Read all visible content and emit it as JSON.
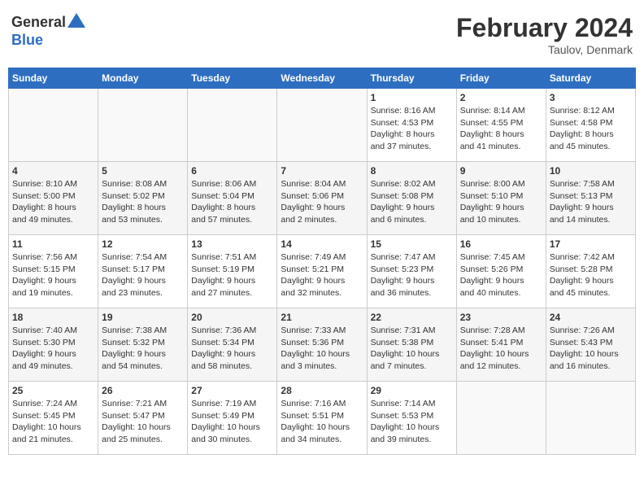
{
  "header": {
    "logo_general": "General",
    "logo_blue": "Blue",
    "title": "February 2024",
    "location": "Taulov, Denmark"
  },
  "weekdays": [
    "Sunday",
    "Monday",
    "Tuesday",
    "Wednesday",
    "Thursday",
    "Friday",
    "Saturday"
  ],
  "weeks": [
    [
      {
        "day": "",
        "info": ""
      },
      {
        "day": "",
        "info": ""
      },
      {
        "day": "",
        "info": ""
      },
      {
        "day": "",
        "info": ""
      },
      {
        "day": "1",
        "info": "Sunrise: 8:16 AM\nSunset: 4:53 PM\nDaylight: 8 hours\nand 37 minutes."
      },
      {
        "day": "2",
        "info": "Sunrise: 8:14 AM\nSunset: 4:55 PM\nDaylight: 8 hours\nand 41 minutes."
      },
      {
        "day": "3",
        "info": "Sunrise: 8:12 AM\nSunset: 4:58 PM\nDaylight: 8 hours\nand 45 minutes."
      }
    ],
    [
      {
        "day": "4",
        "info": "Sunrise: 8:10 AM\nSunset: 5:00 PM\nDaylight: 8 hours\nand 49 minutes."
      },
      {
        "day": "5",
        "info": "Sunrise: 8:08 AM\nSunset: 5:02 PM\nDaylight: 8 hours\nand 53 minutes."
      },
      {
        "day": "6",
        "info": "Sunrise: 8:06 AM\nSunset: 5:04 PM\nDaylight: 8 hours\nand 57 minutes."
      },
      {
        "day": "7",
        "info": "Sunrise: 8:04 AM\nSunset: 5:06 PM\nDaylight: 9 hours\nand 2 minutes."
      },
      {
        "day": "8",
        "info": "Sunrise: 8:02 AM\nSunset: 5:08 PM\nDaylight: 9 hours\nand 6 minutes."
      },
      {
        "day": "9",
        "info": "Sunrise: 8:00 AM\nSunset: 5:10 PM\nDaylight: 9 hours\nand 10 minutes."
      },
      {
        "day": "10",
        "info": "Sunrise: 7:58 AM\nSunset: 5:13 PM\nDaylight: 9 hours\nand 14 minutes."
      }
    ],
    [
      {
        "day": "11",
        "info": "Sunrise: 7:56 AM\nSunset: 5:15 PM\nDaylight: 9 hours\nand 19 minutes."
      },
      {
        "day": "12",
        "info": "Sunrise: 7:54 AM\nSunset: 5:17 PM\nDaylight: 9 hours\nand 23 minutes."
      },
      {
        "day": "13",
        "info": "Sunrise: 7:51 AM\nSunset: 5:19 PM\nDaylight: 9 hours\nand 27 minutes."
      },
      {
        "day": "14",
        "info": "Sunrise: 7:49 AM\nSunset: 5:21 PM\nDaylight: 9 hours\nand 32 minutes."
      },
      {
        "day": "15",
        "info": "Sunrise: 7:47 AM\nSunset: 5:23 PM\nDaylight: 9 hours\nand 36 minutes."
      },
      {
        "day": "16",
        "info": "Sunrise: 7:45 AM\nSunset: 5:26 PM\nDaylight: 9 hours\nand 40 minutes."
      },
      {
        "day": "17",
        "info": "Sunrise: 7:42 AM\nSunset: 5:28 PM\nDaylight: 9 hours\nand 45 minutes."
      }
    ],
    [
      {
        "day": "18",
        "info": "Sunrise: 7:40 AM\nSunset: 5:30 PM\nDaylight: 9 hours\nand 49 minutes."
      },
      {
        "day": "19",
        "info": "Sunrise: 7:38 AM\nSunset: 5:32 PM\nDaylight: 9 hours\nand 54 minutes."
      },
      {
        "day": "20",
        "info": "Sunrise: 7:36 AM\nSunset: 5:34 PM\nDaylight: 9 hours\nand 58 minutes."
      },
      {
        "day": "21",
        "info": "Sunrise: 7:33 AM\nSunset: 5:36 PM\nDaylight: 10 hours\nand 3 minutes."
      },
      {
        "day": "22",
        "info": "Sunrise: 7:31 AM\nSunset: 5:38 PM\nDaylight: 10 hours\nand 7 minutes."
      },
      {
        "day": "23",
        "info": "Sunrise: 7:28 AM\nSunset: 5:41 PM\nDaylight: 10 hours\nand 12 minutes."
      },
      {
        "day": "24",
        "info": "Sunrise: 7:26 AM\nSunset: 5:43 PM\nDaylight: 10 hours\nand 16 minutes."
      }
    ],
    [
      {
        "day": "25",
        "info": "Sunrise: 7:24 AM\nSunset: 5:45 PM\nDaylight: 10 hours\nand 21 minutes."
      },
      {
        "day": "26",
        "info": "Sunrise: 7:21 AM\nSunset: 5:47 PM\nDaylight: 10 hours\nand 25 minutes."
      },
      {
        "day": "27",
        "info": "Sunrise: 7:19 AM\nSunset: 5:49 PM\nDaylight: 10 hours\nand 30 minutes."
      },
      {
        "day": "28",
        "info": "Sunrise: 7:16 AM\nSunset: 5:51 PM\nDaylight: 10 hours\nand 34 minutes."
      },
      {
        "day": "29",
        "info": "Sunrise: 7:14 AM\nSunset: 5:53 PM\nDaylight: 10 hours\nand 39 minutes."
      },
      {
        "day": "",
        "info": ""
      },
      {
        "day": "",
        "info": ""
      }
    ]
  ]
}
